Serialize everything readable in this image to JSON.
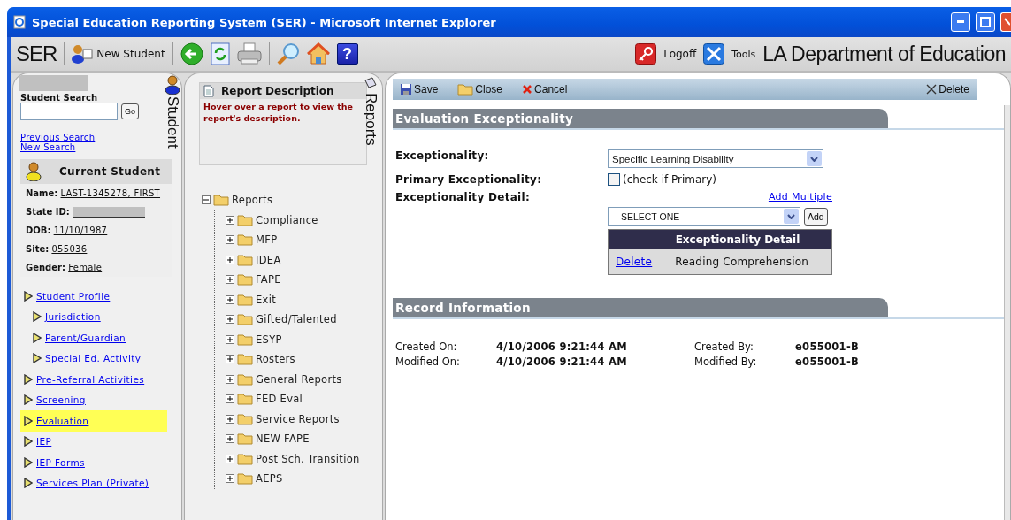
{
  "window": {
    "title": "Special Education Reporting System (SER) - Microsoft Internet Explorer"
  },
  "toolbar": {
    "app_name": "SER",
    "new_student": "New Student",
    "help": "?",
    "logoff": "Logoff",
    "tools": "Tools",
    "organization": "LA Department of Education"
  },
  "student_panel": {
    "tab_label": "Student",
    "search_label": "Student Search",
    "search_button": "Go",
    "links": [
      "Previous Search",
      "New Search"
    ],
    "current_student": {
      "title": "Current Student",
      "fields": [
        {
          "label": "Name:",
          "value": "LAST-1345278, FIRST",
          "kind": "text"
        },
        {
          "label": "State ID:",
          "kind": "redacted"
        },
        {
          "label": "DOB:",
          "value": "11/10/1987",
          "kind": "text"
        },
        {
          "label": "Site:",
          "value": "055036",
          "kind": "text"
        },
        {
          "label": "Gender:",
          "value": "Female",
          "kind": "text"
        }
      ]
    },
    "nav": [
      {
        "label": "Student Profile",
        "selected": false,
        "children": [
          {
            "label": "Jurisdiction",
            "selected": false
          },
          {
            "label": "Parent/Guardian",
            "selected": false
          },
          {
            "label": "Special Ed. Activity",
            "selected": false
          }
        ]
      },
      {
        "label": "Pre-Referral Activities",
        "selected": false
      },
      {
        "label": "Screening",
        "selected": false
      },
      {
        "label": "Evaluation",
        "selected": true
      },
      {
        "label": "IEP",
        "selected": false
      },
      {
        "label": "IEP Forms",
        "selected": false
      },
      {
        "label": "Services Plan (Private)",
        "selected": false
      }
    ]
  },
  "reports_panel": {
    "tab_label": "Reports",
    "description_title": "Report Description",
    "description_text": "Hover over a report to view the report's description.",
    "tree": {
      "label": "Reports",
      "expanded": true,
      "children": [
        {
          "label": "Compliance",
          "expanded": false
        },
        {
          "label": "MFP",
          "expanded": false
        },
        {
          "label": "IDEA",
          "expanded": false
        },
        {
          "label": "FAPE",
          "expanded": false
        },
        {
          "label": "Exit",
          "expanded": false
        },
        {
          "label": "Gifted/Talented",
          "expanded": false
        },
        {
          "label": "ESYP",
          "expanded": false
        },
        {
          "label": "Rosters",
          "expanded": false
        },
        {
          "label": "General Reports",
          "expanded": false
        },
        {
          "label": "FED Eval",
          "expanded": false
        },
        {
          "label": "Service Reports",
          "expanded": false
        },
        {
          "label": "NEW FAPE",
          "expanded": false
        },
        {
          "label": "Post Sch. Transition",
          "expanded": false
        },
        {
          "label": "AEPS",
          "expanded": false
        }
      ]
    }
  },
  "main": {
    "actions": [
      {
        "label": "Save",
        "kind": "save"
      },
      {
        "label": "Close",
        "kind": "close"
      },
      {
        "label": "Cancel",
        "kind": "cancel"
      },
      {
        "label": "Delete",
        "kind": "delete"
      }
    ],
    "exceptionality_section": {
      "title": "Evaluation Exceptionality",
      "exceptionality": {
        "label": "Exceptionality:",
        "value": "Specific Learning Disability"
      },
      "primary": {
        "label": "Primary Exceptionality:",
        "checkbox_text": "(check if Primary)",
        "checked": false
      },
      "detail": {
        "label": "Exceptionality Detail:",
        "add_multiple": "Add Multiple",
        "select_placeholder": "-- SELECT ONE --",
        "add_button": "Add",
        "table": {
          "header": "Exceptionality Detail",
          "rows": [
            {
              "action": "Delete",
              "value": "Reading Comprehension"
            }
          ]
        }
      }
    },
    "record_section": {
      "title": "Record Information",
      "rows": [
        {
          "label": "Created On:",
          "value": "4/10/2006 9:21:44 AM",
          "by_label": "Created By:",
          "by_value": "e055001-B"
        },
        {
          "label": "Modified On:",
          "value": "4/10/2006 9:21:44 AM",
          "by_label": "Modified By:",
          "by_value": "e055001-B"
        }
      ]
    }
  }
}
